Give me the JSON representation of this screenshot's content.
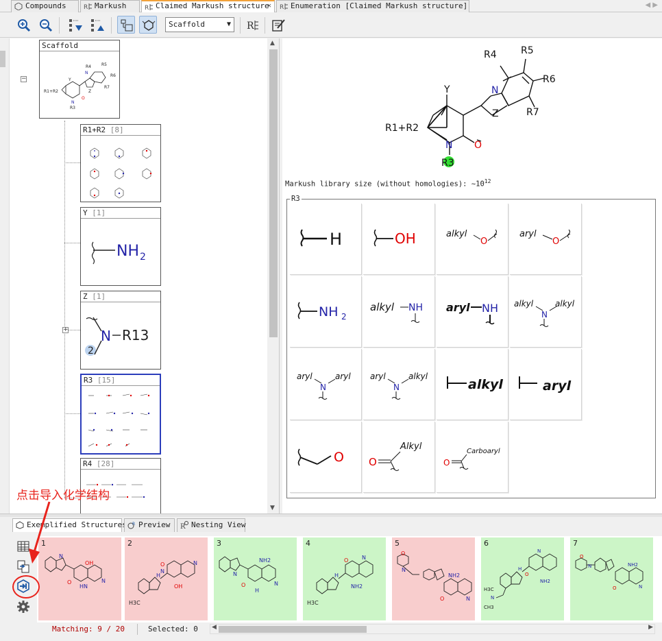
{
  "tabs": [
    {
      "label": "Compounds",
      "icon": "compounds-icon",
      "active": false
    },
    {
      "label": "Markush",
      "icon": "markush-icon",
      "active": false
    },
    {
      "label": "Claimed Markush structure",
      "icon": "markush-icon",
      "active": true
    },
    {
      "label": "Enumeration [Claimed Markush structure]",
      "icon": "markush-icon",
      "active": false
    }
  ],
  "toolbar": {
    "scaffold_select": "Scaffold",
    "r_button": "R"
  },
  "tree": {
    "scaffold_label": "Scaffold",
    "nodes": [
      {
        "label": "R1+R2",
        "count": "[8]"
      },
      {
        "label": "Y",
        "count": "[1]"
      },
      {
        "label": "Z",
        "count": "[1]"
      },
      {
        "label": "R3",
        "count": "[15]"
      },
      {
        "label": "R4",
        "count": "[28]"
      }
    ],
    "y_group": "NH",
    "y_group_sub": "2",
    "z_group_n": "N",
    "z_group_r": "R13",
    "z_group_attach": "2"
  },
  "scaffold_labels": {
    "r4": "R4",
    "r5": "R5",
    "r6": "R6",
    "r7": "R7",
    "n_imine": "N",
    "z": "Z",
    "y": "Y",
    "r1r2": "R1+R2",
    "n_ring": "N",
    "o": "O",
    "r3": "R3"
  },
  "library_size": {
    "text": "Markush library size (without homologies): ~10",
    "exponent": "12"
  },
  "r_group": {
    "title": "R3",
    "cells": [
      {
        "parts": [
          "H"
        ]
      },
      {
        "parts": [
          "OH"
        ]
      },
      {
        "parts": [
          "alkyl",
          "O"
        ]
      },
      {
        "parts": [
          "aryl",
          "O"
        ]
      },
      {
        "parts": [
          "NH",
          "2"
        ]
      },
      {
        "parts": [
          "alkyl",
          "NH"
        ]
      },
      {
        "parts": [
          "aryl",
          "NH"
        ]
      },
      {
        "parts": [
          "alkyl",
          "N",
          "alkyl"
        ]
      },
      {
        "parts": [
          "aryl",
          "N",
          "aryl"
        ]
      },
      {
        "parts": [
          "aryl",
          "N",
          "alkyl"
        ]
      },
      {
        "parts": [
          "alkyl"
        ]
      },
      {
        "parts": [
          "aryl"
        ]
      },
      {
        "parts": [
          "O"
        ]
      },
      {
        "parts": [
          "O",
          "Alkyl"
        ]
      },
      {
        "parts": [
          "O",
          "Carboaryl"
        ]
      }
    ]
  },
  "bottom": {
    "tabs": [
      {
        "label": "Exemplified Structures",
        "active": true
      },
      {
        "label": "Preview",
        "active": false
      },
      {
        "label": "Nesting View",
        "active": false
      }
    ],
    "examples": [
      {
        "num": "1",
        "state": "pink",
        "atoms": [
          "N",
          "OH",
          "HN",
          "O",
          "N"
        ]
      },
      {
        "num": "2",
        "state": "pink",
        "atoms": [
          "H",
          "N",
          "O",
          "N",
          "OH",
          "H3C"
        ]
      },
      {
        "num": "3",
        "state": "green",
        "atoms": [
          "NH2",
          "N",
          "O",
          "N",
          "H"
        ]
      },
      {
        "num": "4",
        "state": "green",
        "atoms": [
          "H",
          "N",
          "O",
          "NH2",
          "H3C"
        ]
      },
      {
        "num": "5",
        "state": "pink",
        "atoms": [
          "O",
          "N",
          "NH2",
          "O",
          "N"
        ]
      },
      {
        "num": "6",
        "state": "green",
        "atoms": [
          "H",
          "N",
          "O",
          "NH2",
          "H3C",
          "N",
          "CH3"
        ]
      },
      {
        "num": "7",
        "state": "green",
        "atoms": [
          "O",
          "N",
          "NH2",
          "O",
          "N"
        ]
      }
    ],
    "matching": "Matching: 9 / 20",
    "selected": "Selected: 0"
  },
  "annotation": {
    "text": "点击导入化学结构",
    "color": "#e8231c"
  },
  "colors": {
    "tab_accent": "#f2a23a",
    "selection_blue": "#2b3dbb",
    "pink_bg": "#f8cdcd",
    "green_bg": "#ccf5c7",
    "atom_blue": "#2424a8",
    "atom_red": "#e00000",
    "highlight_green": "#33e033",
    "status_red": "#b00000"
  }
}
